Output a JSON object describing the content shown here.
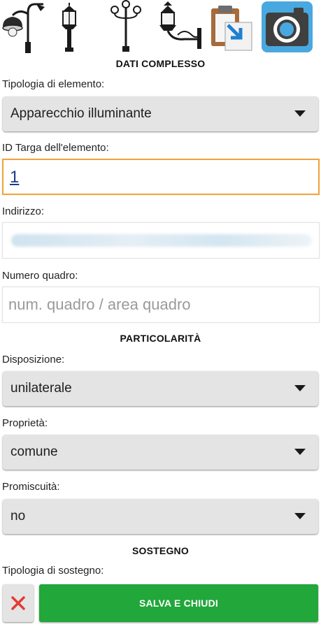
{
  "toolbar": {
    "icons": [
      "street-lamp-icon",
      "lantern-lamp-icon",
      "candelabra-lamp-icon",
      "wall-lamp-icon",
      "paste-icon",
      "camera-icon"
    ]
  },
  "complex": {
    "title": "DATI COMPLESSO",
    "type_label": "Tipologia di elemento:",
    "type_value": "Apparecchio illuminante",
    "id_label": "ID Targa dell'elemento:",
    "id_value": "1",
    "address_label": "Indirizzo:",
    "quadro_label": "Numero quadro:",
    "quadro_placeholder": "num. quadro / area quadro"
  },
  "particularity": {
    "title": "PARTICOLARITÀ",
    "disposition_label": "Disposizione:",
    "disposition_value": "unilaterale",
    "ownership_label": "Proprietà:",
    "ownership_value": "comune",
    "promiscuity_label": "Promiscuità:",
    "promiscuity_value": "no"
  },
  "support": {
    "title": "SOSTEGNO",
    "type_label": "Tipologia di sostegno:"
  },
  "actions": {
    "save_label": "SALVA E CHIUDI"
  },
  "colors": {
    "save_button": "#21a73a",
    "cancel_icon": "#e53935",
    "focus_border": "#f2a33a",
    "camera_bg": "#4aa8e0"
  }
}
